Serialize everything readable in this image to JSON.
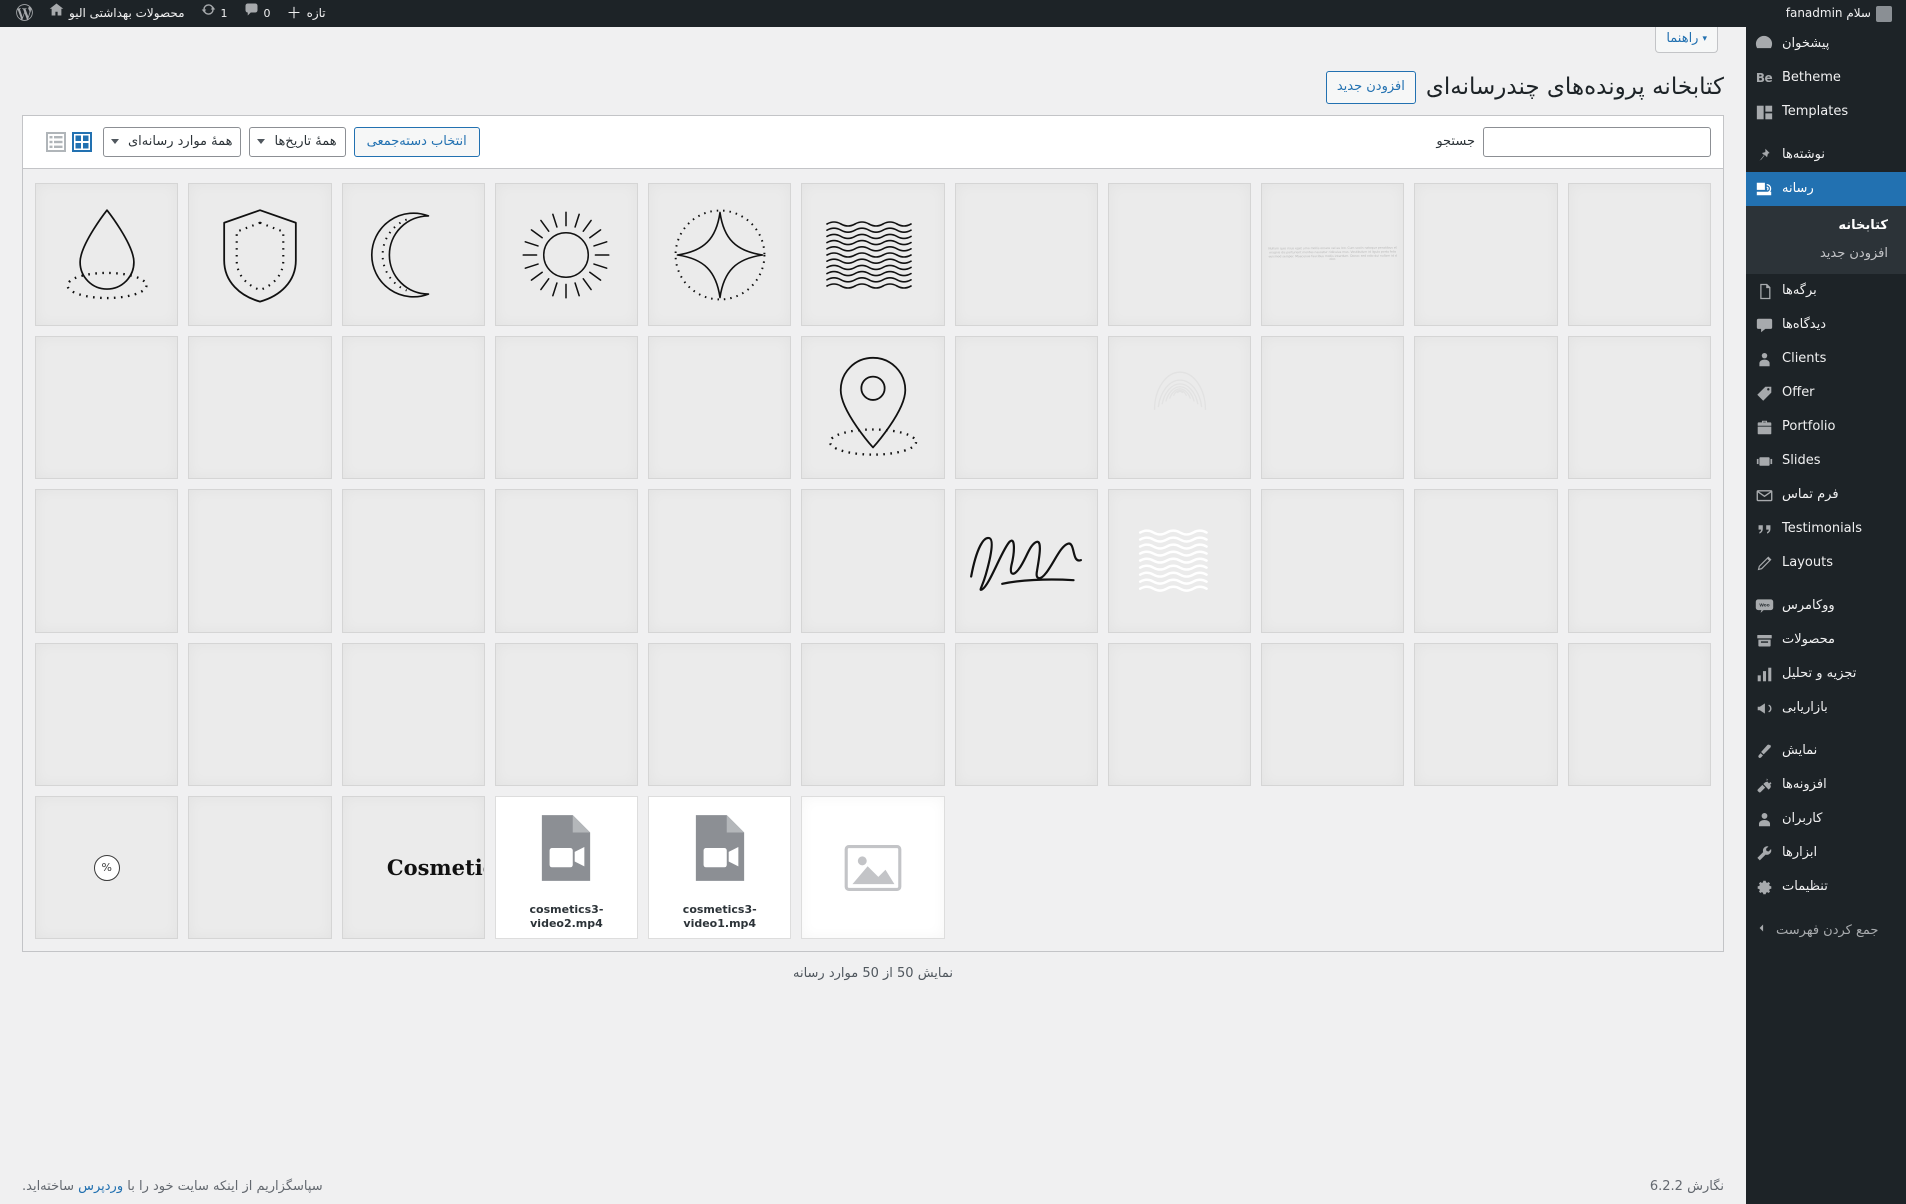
{
  "adminbar": {
    "wp_logo": "wordpress-logo",
    "site_name": "محصولات بهداشتی الیو",
    "home_icon": "home-icon",
    "updates_count": "1",
    "updates_icon": "updates-icon",
    "comments_count": "0",
    "comments_icon": "comment-bubble-icon",
    "new_label": "تازه",
    "new_icon": "plus-icon",
    "howdy": "سلام fanadmin",
    "avatar": "user-avatar"
  },
  "sidebar": {
    "items": [
      {
        "label": "پیشخوان",
        "icon": "dashboard-icon",
        "name": "dashboard"
      },
      {
        "label": "Betheme",
        "icon": "betheme-icon",
        "name": "betheme"
      },
      {
        "label": "Templates",
        "icon": "templates-icon",
        "name": "templates"
      },
      {
        "sep": true
      },
      {
        "label": "نوشته‌ها",
        "icon": "pin-icon",
        "name": "posts"
      },
      {
        "label": "رسانه",
        "icon": "media-icon",
        "name": "media",
        "current": true,
        "submenu": [
          {
            "label": "کتابخانه",
            "name": "library",
            "current": true
          },
          {
            "label": "افزودن جدید",
            "name": "add-new"
          }
        ]
      },
      {
        "label": "برگه‌ها",
        "icon": "page-icon",
        "name": "pages"
      },
      {
        "label": "دیدگاه‌ها",
        "icon": "comments-icon",
        "name": "comments"
      },
      {
        "label": "Clients",
        "icon": "clients-icon",
        "name": "clients"
      },
      {
        "label": "Offer",
        "icon": "offer-icon",
        "name": "offer"
      },
      {
        "label": "Portfolio",
        "icon": "portfolio-icon",
        "name": "portfolio"
      },
      {
        "label": "Slides",
        "icon": "slides-icon",
        "name": "slides"
      },
      {
        "label": "فرم تماس",
        "icon": "envelope-icon",
        "name": "contact-form"
      },
      {
        "label": "Testimonials",
        "icon": "quote-icon",
        "name": "testimonials"
      },
      {
        "label": "Layouts",
        "icon": "pencil-icon",
        "name": "layouts"
      },
      {
        "sep": true
      },
      {
        "label": "ووکامرس",
        "icon": "woo-icon",
        "name": "woocommerce"
      },
      {
        "label": "محصولات",
        "icon": "products-icon",
        "name": "products"
      },
      {
        "label": "تجزیه و تحلیل",
        "icon": "analytics-icon",
        "name": "analytics"
      },
      {
        "label": "بازاریابی",
        "icon": "megaphone-icon",
        "name": "marketing"
      },
      {
        "sep": true
      },
      {
        "label": "نمایش",
        "icon": "appearance-icon",
        "name": "appearance"
      },
      {
        "label": "افزونه‌ها",
        "icon": "plugin-icon",
        "name": "plugins"
      },
      {
        "label": "کاربران",
        "icon": "users-icon",
        "name": "users"
      },
      {
        "label": "ابزارها",
        "icon": "tools-icon",
        "name": "tools"
      },
      {
        "label": "تنظیمات",
        "icon": "settings-icon",
        "name": "settings"
      }
    ],
    "collapse_label": "جمع کردن فهرست",
    "collapse_icon": "collapse-arrow-icon"
  },
  "screen_meta": {
    "help_label": "راهنما",
    "help_caret": "▾"
  },
  "page": {
    "title": "کتابخانه پرونده‌های چندرسانه‌ای",
    "add_new_label": "افزودن جدید"
  },
  "toolbar": {
    "media_type_filter": "همهٔ موارد رسانه‌ای",
    "date_filter": "همهٔ تاریخ‌ها",
    "bulk_select_label": "انتخاب دسته‌جمعی",
    "search_label": "جستجو",
    "search_value": "",
    "search_placeholder": "",
    "grid_view_icon": "grid-view-icon",
    "list_view_icon": "list-view-icon",
    "active_view": "grid"
  },
  "status": {
    "count_text": "نمایش 50 از 50 موارد رسانه"
  },
  "footer": {
    "thanks_prefix": "سپاسگزاریم از اینکه سایت خود را با ",
    "wp_link": "وردپرس",
    "thanks_suffix": " ساخته‌اید.",
    "version": "نگارش 6.2.2"
  },
  "colors": {
    "admin_bar_bg": "#1d2327",
    "sidebar_bg": "#1d2327",
    "sidebar_current": "#2271b1",
    "submenu_bg": "#2c3338",
    "accent": "#2271b1",
    "content_bg": "#f0f0f1",
    "tile_bg": "#ebebeb",
    "badge_red": "#d63638"
  },
  "attachments": [
    {
      "kind": "blank",
      "name": "attachment-1"
    },
    {
      "kind": "blank",
      "name": "attachment-2"
    },
    {
      "kind": "blank",
      "name": "attachment-3"
    },
    {
      "kind": "blank",
      "name": "attachment-4"
    },
    {
      "kind": "blank",
      "name": "attachment-5"
    },
    {
      "kind": "icon",
      "icon": "waves-icon",
      "name": "attachment-6"
    },
    {
      "kind": "icon",
      "icon": "sparkle-icon",
      "name": "attachment-7"
    },
    {
      "kind": "icon",
      "icon": "sun-icon",
      "name": "attachment-8"
    },
    {
      "kind": "icon",
      "icon": "moon-icon",
      "name": "attachment-9"
    },
    {
      "kind": "icon",
      "icon": "shield-icon",
      "name": "attachment-10"
    },
    {
      "kind": "icon",
      "icon": "droplet-icon",
      "name": "attachment-11"
    },
    {
      "kind": "blank",
      "name": "attachment-12"
    },
    {
      "kind": "blank",
      "name": "attachment-13"
    },
    {
      "kind": "blank",
      "name": "attachment-14"
    },
    {
      "kind": "fingerprint",
      "name": "attachment-15"
    },
    {
      "kind": "blank",
      "name": "attachment-16"
    },
    {
      "kind": "icon",
      "icon": "location-pin-icon",
      "name": "attachment-17"
    },
    {
      "kind": "blank",
      "name": "attachment-18"
    },
    {
      "kind": "blank",
      "name": "attachment-19"
    },
    {
      "kind": "blank",
      "name": "attachment-20"
    },
    {
      "kind": "blank",
      "name": "attachment-21"
    },
    {
      "kind": "blank",
      "name": "attachment-22"
    },
    {
      "kind": "blank",
      "name": "attachment-23"
    },
    {
      "kind": "blank",
      "name": "attachment-24"
    },
    {
      "kind": "blank",
      "name": "attachment-25"
    },
    {
      "kind": "icon",
      "icon": "white-waves-icon",
      "name": "attachment-26"
    },
    {
      "kind": "icon",
      "icon": "signature-icon",
      "name": "attachment-27"
    },
    {
      "kind": "blank",
      "name": "attachment-28"
    },
    {
      "kind": "blank",
      "name": "attachment-29"
    },
    {
      "kind": "blank",
      "name": "attachment-30"
    },
    {
      "kind": "blank",
      "name": "attachment-31"
    },
    {
      "kind": "blank",
      "name": "attachment-32"
    },
    {
      "kind": "blank",
      "name": "attachment-33"
    },
    {
      "kind": "blank",
      "name": "attachment-34"
    },
    {
      "kind": "blank",
      "name": "attachment-35"
    },
    {
      "kind": "blank",
      "name": "attachment-36"
    },
    {
      "kind": "blank",
      "name": "attachment-37"
    },
    {
      "kind": "blank",
      "name": "attachment-38"
    },
    {
      "kind": "blank",
      "name": "attachment-39"
    },
    {
      "kind": "blank",
      "name": "attachment-40"
    },
    {
      "kind": "blank",
      "name": "attachment-41"
    },
    {
      "kind": "blank",
      "name": "attachment-42"
    },
    {
      "kind": "blank",
      "name": "attachment-43"
    },
    {
      "kind": "blank",
      "name": "attachment-44"
    },
    {
      "kind": "empty",
      "name": "spacer-1"
    },
    {
      "kind": "empty",
      "name": "spacer-2"
    },
    {
      "kind": "empty",
      "name": "spacer-3"
    },
    {
      "kind": "empty",
      "name": "spacer-4"
    },
    {
      "kind": "empty",
      "name": "spacer-5"
    },
    {
      "kind": "placeholder",
      "icon": "image-placeholder-icon",
      "name": "attachment-45"
    },
    {
      "kind": "video",
      "filename": "cosmetics3-video1.mp4",
      "icon": "video-file-icon",
      "name": "attachment-46"
    },
    {
      "kind": "video",
      "filename": "cosmetics3-video2.mp4",
      "icon": "video-file-icon",
      "name": "attachment-47"
    },
    {
      "kind": "text",
      "text": "Cosmetic",
      "name": "attachment-48"
    },
    {
      "kind": "blank",
      "name": "attachment-49"
    },
    {
      "kind": "percent",
      "text": "%",
      "name": "attachment-50"
    }
  ]
}
